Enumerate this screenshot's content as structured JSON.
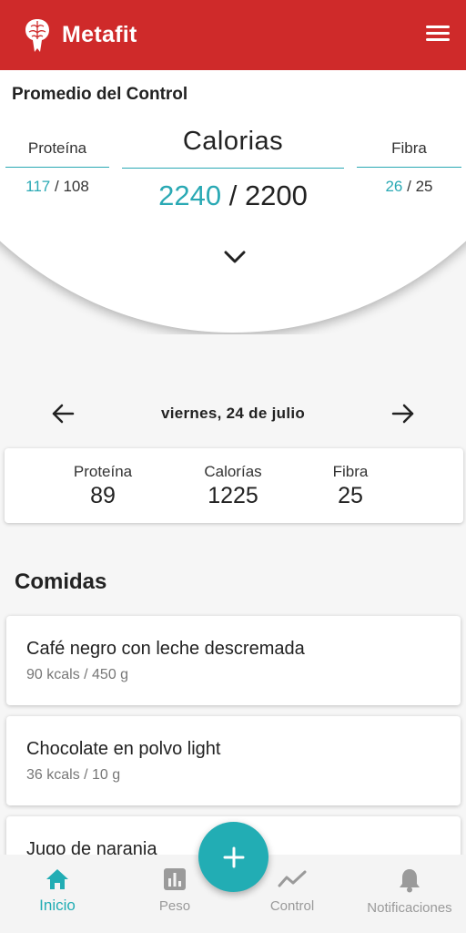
{
  "app": {
    "title": "Metafit"
  },
  "summary": {
    "title": "Promedio del Control",
    "protein": {
      "label": "Proteína",
      "current": "117",
      "target": "108"
    },
    "calories": {
      "label": "Calorias",
      "current": "2240",
      "target": "2200"
    },
    "fiber": {
      "label": "Fibra",
      "current": "26",
      "target": "25"
    },
    "separator": "/"
  },
  "date": {
    "text": "viernes, 24 de julio"
  },
  "day": {
    "protein": {
      "label": "Proteína",
      "value": "89"
    },
    "calories": {
      "label": "Calorías",
      "value": "1225"
    },
    "fiber": {
      "label": "Fibra",
      "value": "25"
    }
  },
  "meals": {
    "title": "Comidas",
    "items": [
      {
        "name": "Café negro con leche descremada",
        "detail": "90 kcals / 450 g"
      },
      {
        "name": "Chocolate en polvo light",
        "detail": "36 kcals / 10 g"
      },
      {
        "name": "Jugo de naranja",
        "detail": ""
      }
    ]
  },
  "fab": {
    "icon": "plus-icon"
  },
  "nav": {
    "items": [
      {
        "label": "Inicio",
        "icon": "home-icon",
        "active": true
      },
      {
        "label": "Peso",
        "icon": "bar-chart-icon",
        "active": false
      },
      {
        "label": "Control",
        "icon": "trend-line-icon",
        "active": false
      },
      {
        "label": "Notificaciones",
        "icon": "bell-icon",
        "active": false
      }
    ]
  },
  "colors": {
    "brand": "#cf2a2a",
    "accent": "#2aa9b4",
    "fab": "#22adb4"
  }
}
